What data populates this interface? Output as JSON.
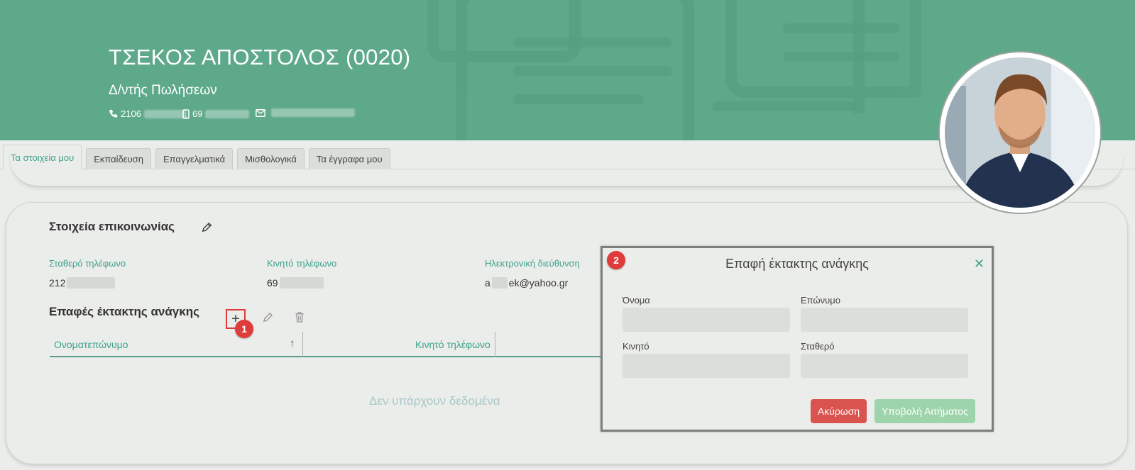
{
  "header": {
    "name": "ΤΣΕΚΟΣ ΑΠΟΣΤΟΛΟΣ (0020)",
    "role": "Δ/ντής Πωλήσεων",
    "phone_fixed_prefix": "2106",
    "phone_mobile_prefix": "69",
    "email_prefix": ""
  },
  "tabs": [
    {
      "label": "Τα στοιχεία μου",
      "active": true
    },
    {
      "label": "Εκπαίδευση"
    },
    {
      "label": "Επαγγελματικά"
    },
    {
      "label": "Μισθολογικά"
    },
    {
      "label": "Τα έγγραφα μου"
    }
  ],
  "contact_section": {
    "title": "Στοιχεία επικοινωνίας",
    "fixed_phone_label": "Σταθερό τηλέφωνο",
    "fixed_phone_value": "212",
    "mobile_label": "Κινητό τηλέφωνο",
    "mobile_value": "69",
    "email_label": "Ηλεκτρονική διεύθυνση",
    "email_value_start": "a",
    "email_value_end": "ek@yahoo.gr"
  },
  "emergency_section": {
    "title": "Επαφές έκτακτης ανάγκης",
    "add_symbol": "+",
    "columns": [
      "Ονοματεπώνυμο",
      "Κινητό τηλέφωνο"
    ],
    "sort_symbol": "↑",
    "empty_text": "Δεν υπάρχουν δεδομένα"
  },
  "badges": {
    "one": "1",
    "two": "2"
  },
  "dialog": {
    "title": "Επαφή έκτακτης ανάγκης",
    "close_symbol": "✕",
    "first_name_label": "Όνομα",
    "last_name_label": "Επώνυμο",
    "mobile_label": "Κινητό",
    "fixed_label": "Σταθερό",
    "first_name_value": "",
    "last_name_value": "",
    "mobile_value": "",
    "fixed_value": "",
    "cancel_label": "Ακύρωση",
    "submit_label": "Υποβολή Αιτήματος"
  },
  "colors": {
    "banner": "#5fa98a",
    "accent": "#3fa18c",
    "danger": "#d9534f",
    "submit_disabled": "#9ed4ab"
  },
  "icons": {
    "phone": "phone-icon",
    "mobile": "mobile-icon",
    "mail": "mail-icon",
    "pencil": "pencil-icon",
    "trash": "trash-icon",
    "plus": "plus-icon",
    "close": "close-icon",
    "sort": "sort-arrow-icon"
  }
}
